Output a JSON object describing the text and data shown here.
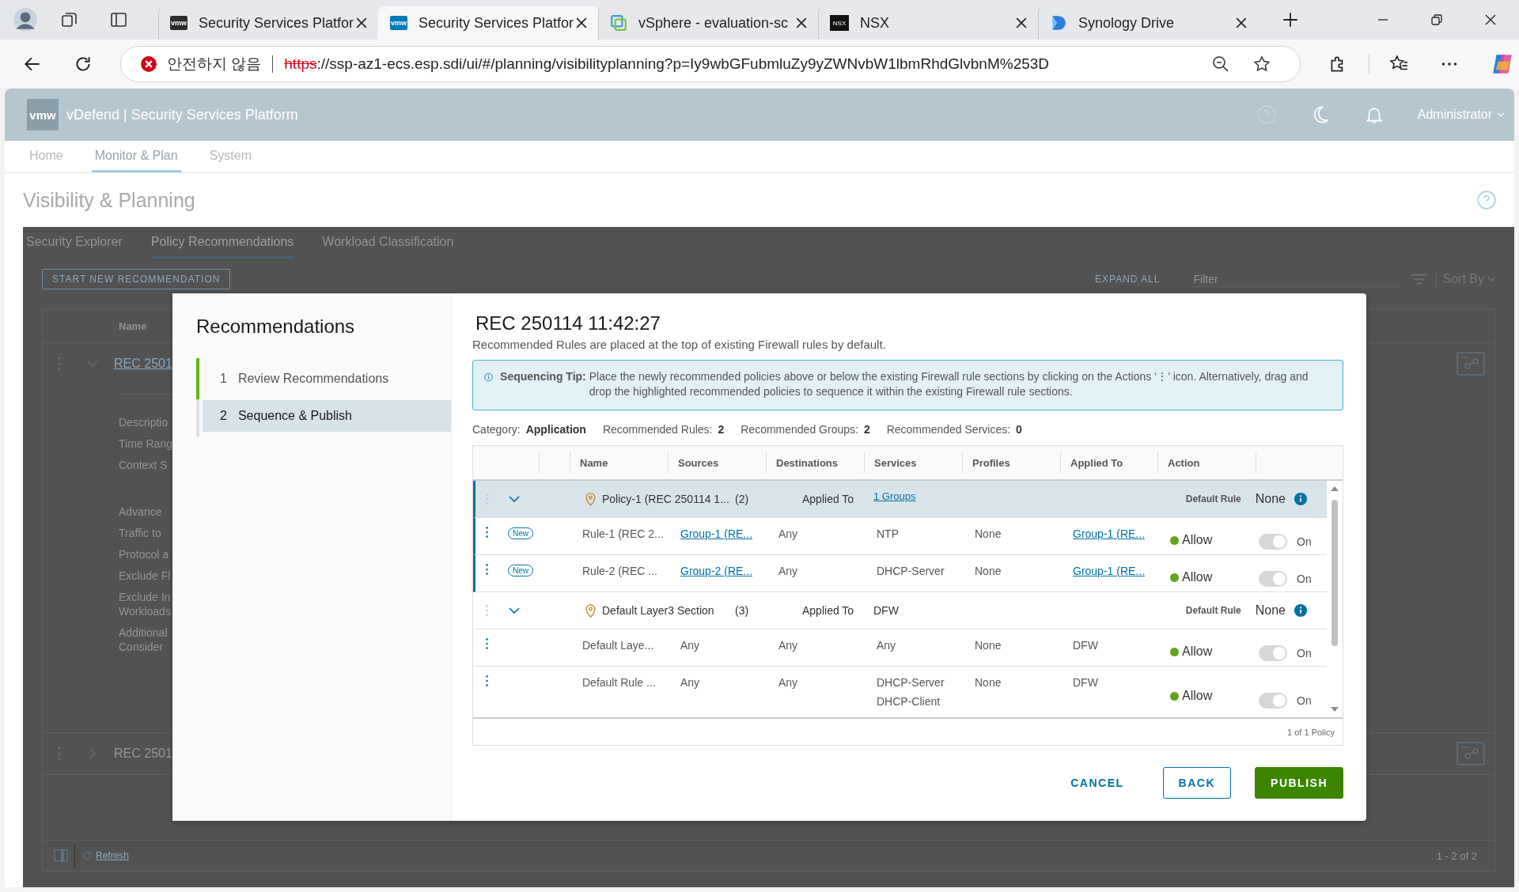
{
  "browser": {
    "tabs": [
      {
        "title": "Security Services Platfor",
        "kind": "vmw",
        "logo_text": "vmw",
        "selected": false
      },
      {
        "title": "Security Services Platfor",
        "kind": "vmw",
        "logo_text": "vmw",
        "selected": true
      },
      {
        "title": "vSphere - evaluation-sc",
        "kind": "vsphere",
        "selected": false
      },
      {
        "title": "NSX",
        "kind": "nsx",
        "logo_text": "NSX",
        "selected": false
      },
      {
        "title": "Synology Drive",
        "kind": "drive",
        "selected": false
      }
    ],
    "address": {
      "warning": "안전하지 않음",
      "scheme": "https",
      "rest": "://ssp-az1-ecs.esp.sdi/ui/#/planning/visibilityplanning?p=Iy9wbGFubmluZy9yZWNvbW1lbmRhdGlvbnM%253D"
    }
  },
  "app": {
    "logo_text": "vmw",
    "title": "vDefend | Security Services Platform",
    "user": "Administrator",
    "nav": [
      {
        "label": "Home",
        "selected": false
      },
      {
        "label": "Monitor & Plan",
        "selected": true
      },
      {
        "label": "System",
        "selected": false
      }
    ],
    "page_title": "Visibility & Planning"
  },
  "background": {
    "tabs": [
      {
        "label": "Security Explorer",
        "selected": false
      },
      {
        "label": "Policy Recommendations",
        "selected": true
      },
      {
        "label": "Workload Classification",
        "selected": false
      }
    ],
    "start_button": "START NEW RECOMMENDATION",
    "expand_all": "EXPAND ALL",
    "filter_placeholder": "Filter",
    "sort_label": "Sort By",
    "column": "Name",
    "rows": [
      {
        "name": "REC 2501",
        "expanded": true,
        "details": [
          "Descriptio",
          "Time Rang",
          "Context S",
          "Advance",
          "Traffic to",
          "Protocol a",
          "Exclude Fl",
          "Exclude In\nWorkloads",
          "Additional\nConsider"
        ]
      },
      {
        "name": "REC 2501",
        "expanded": false,
        "details": []
      }
    ],
    "refresh": "Refresh",
    "pagination": "1 - 2 of 2"
  },
  "modal": {
    "heading": "Recommendations",
    "steps": [
      {
        "number": "1",
        "label": "Review Recommendations",
        "done": true,
        "selected": false
      },
      {
        "number": "2",
        "label": "Sequence & Publish",
        "done": false,
        "selected": true
      }
    ],
    "title": "REC 250114 11:42:27",
    "subtitle": "Recommended Rules are placed at the top of existing Firewall rules by default.",
    "tip": {
      "label": "Sequencing Tip:",
      "text": "Place the newly recommended policies above or below the existing Firewall rule sections by clicking on the Actions ‘⋮’ icon. Alternatively, drag and drop the highlighted recommended policies to sequence it within the existing Firewall rule sections."
    },
    "stats": [
      {
        "label": "Category:",
        "value": "Application"
      },
      {
        "label": "Recommended Rules:",
        "value": "2"
      },
      {
        "label": "Recommended Groups:",
        "value": "2"
      },
      {
        "label": "Recommended Services:",
        "value": "0"
      }
    ],
    "columns": [
      "Name",
      "Sources",
      "Destinations",
      "Services",
      "Profiles",
      "Applied To",
      "Action"
    ],
    "sections": [
      {
        "name": "Policy-1 (REC 250114 1...",
        "count": "(2)",
        "applied_label": "Applied To",
        "applied": "1 Groups",
        "applied_link": true,
        "default_label": "Default Rule",
        "default_value": "None",
        "expanded": true,
        "highlighted": true,
        "rules": [
          {
            "badge": "New",
            "name": "Rule-1 (REC 2...",
            "sources": "Group-1 (RE...",
            "sources_link": true,
            "destinations": "Any",
            "services": [
              "NTP"
            ],
            "profiles": "None",
            "applied_to": "Group-1 (RE...",
            "applied_link": true,
            "action": "Allow",
            "color": "#62a420",
            "on": true,
            "on_label": "On",
            "highlighted": true
          },
          {
            "badge": "New",
            "name": "Rule-2 (REC ...",
            "sources": "Group-2 (RE...",
            "sources_link": true,
            "destinations": "Any",
            "services": [
              "DHCP-Server"
            ],
            "profiles": "None",
            "applied_to": "Group-1 (RE...",
            "applied_link": true,
            "action": "Allow",
            "color": "#62a420",
            "on": true,
            "on_label": "On",
            "highlighted": true
          }
        ]
      },
      {
        "name": "Default Layer3 Section",
        "count": "(3)",
        "applied_label": "Applied To",
        "applied": "DFW",
        "applied_link": false,
        "default_label": "Default Rule",
        "default_value": "None",
        "expanded": true,
        "highlighted": false,
        "rules": [
          {
            "name": "Default Laye...",
            "sources": "Any",
            "sources_link": false,
            "destinations": "Any",
            "services": [
              "Any"
            ],
            "profiles": "None",
            "applied_to": "DFW",
            "applied_link": false,
            "action": "Allow",
            "color": "#62a420",
            "on": true,
            "on_label": "On",
            "highlighted": false
          },
          {
            "name": "Default Rule ...",
            "sources": "Any",
            "sources_link": false,
            "destinations": "Any",
            "services": [
              "DHCP-Server",
              "DHCP-Client"
            ],
            "profiles": "None",
            "applied_to": "DFW",
            "applied_link": false,
            "action": "Allow",
            "color": "#62a420",
            "on": true,
            "on_label": "On",
            "highlighted": false
          }
        ]
      }
    ],
    "footer": "1 of 1 Policy",
    "buttons": [
      {
        "label": "CANCEL",
        "kind": "flat"
      },
      {
        "label": "BACK",
        "kind": "outline"
      },
      {
        "label": "PUBLISH",
        "kind": "primary"
      }
    ]
  }
}
